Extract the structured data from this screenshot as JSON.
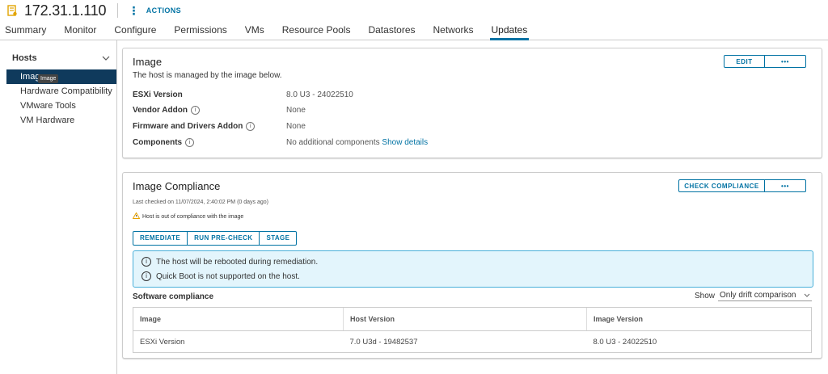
{
  "header": {
    "host": "172.31.1.110",
    "actions_label": "ACTIONS",
    "actions_icon": "vertical-dots-icon"
  },
  "tabs": [
    "Summary",
    "Monitor",
    "Configure",
    "Permissions",
    "VMs",
    "Resource Pools",
    "Datastores",
    "Networks",
    "Updates"
  ],
  "active_tab": "Updates",
  "sidebar": {
    "heading": "Hosts",
    "items": [
      {
        "label": "Image"
      },
      {
        "label": "Hardware Compatibility"
      },
      {
        "label": "VMware Tools"
      },
      {
        "label": "VM Hardware"
      }
    ],
    "tooltip": "Image"
  },
  "image_card": {
    "title": "Image",
    "subtitle": "The host is managed by the image below.",
    "edit_label": "EDIT",
    "more_label": "•••",
    "rows": [
      {
        "key": "ESXi Version",
        "value": "8.0 U3 - 24022510"
      },
      {
        "key": "Vendor Addon",
        "value": "None"
      },
      {
        "key": "Firmware and Drivers Addon",
        "value": "None"
      },
      {
        "key": "Components",
        "value": "No additional components",
        "link": "Show details"
      }
    ]
  },
  "compliance_card": {
    "title": "Image Compliance",
    "check_label": "CHECK COMPLIANCE",
    "more_label": "•••",
    "last_checked": "Last checked on 11/07/2024, 2:40:02 PM (0 days ago)",
    "warning": "Host is out of compliance with the image",
    "buttons": {
      "remediate": "REMEDIATE",
      "precheck": "RUN PRE-CHECK",
      "stage": "STAGE"
    },
    "alerts": [
      "The host will be rebooted during remediation.",
      "Quick Boot is not supported on the host."
    ],
    "software_heading": "Software compliance",
    "show_label": "Show",
    "show_value": "Only drift comparison",
    "table": {
      "columns": [
        "Image",
        "Host Version",
        "Image Version"
      ],
      "rows": [
        {
          "image": "ESXi Version",
          "host": "7.0 U3d - 19482537",
          "imagever": "8.0 U3 - 24022510"
        }
      ]
    }
  },
  "colors": {
    "accent": "#0072a3",
    "selected_bg": "#0f3a5c",
    "alert_bg": "#e3f5fc",
    "warning": "#e8a200"
  }
}
